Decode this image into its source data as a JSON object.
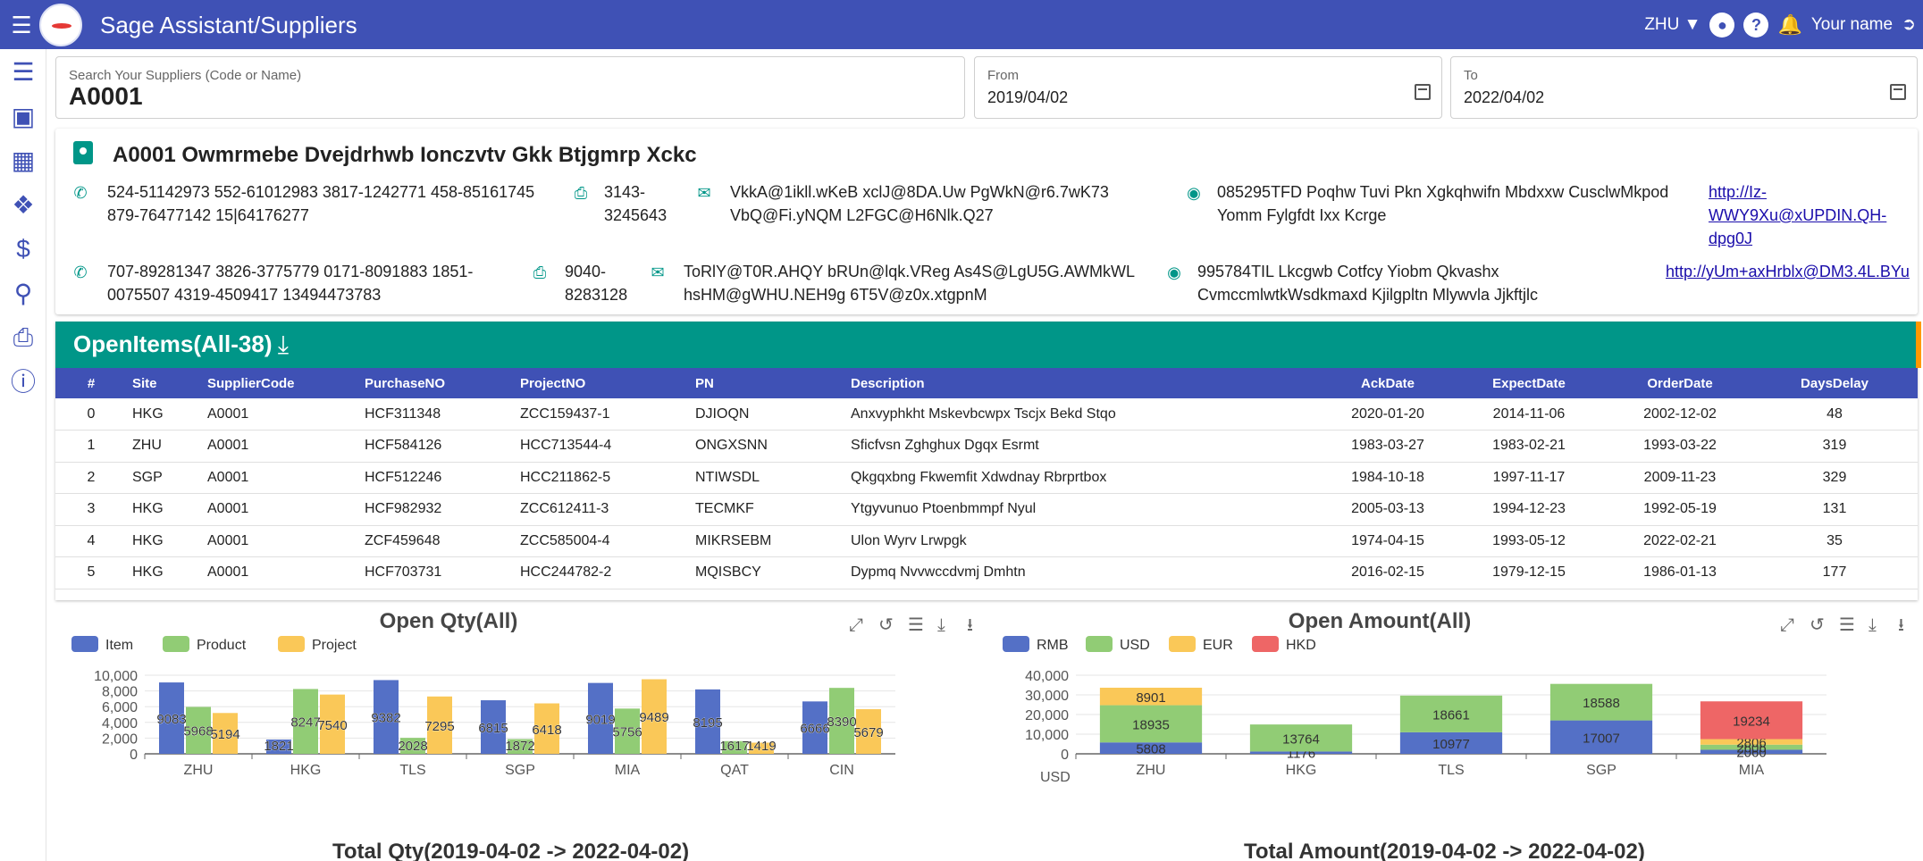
{
  "app": {
    "title": "Sage Assistant/Suppliers",
    "site": "ZHU",
    "user": "Your name"
  },
  "colors": {
    "primary": "#3f51b5",
    "teal": "#009688",
    "accent": "#ff9800"
  },
  "sidebar": {
    "icons": [
      "list-icon",
      "cubes-icon",
      "grid-icon",
      "puzzle-icon",
      "dollar-icon",
      "search-money-icon",
      "print-icon",
      "info-icon"
    ]
  },
  "search": {
    "label": "Search Your Suppliers (Code or Name)",
    "value": "A0001"
  },
  "from": {
    "label": "From",
    "value": "2019/04/02"
  },
  "to": {
    "label": "To",
    "value": "2022/04/02"
  },
  "supplier": {
    "name": "A0001 Owmrmebe Dvejdrhwb Ionczvtv Gkk Btjgmrp Xckc",
    "rows": [
      {
        "phones": [
          "524-51142973 552-61012983 3817-1242771 458-85161745",
          "879-76477142 15|64176277"
        ],
        "fax": [
          "3143-",
          "3245643"
        ],
        "emails": [
          "VkkA@1ikll.wKeB xclJ@8DA.Uw PgWkN@r6.7wK73",
          "VbQ@Fi.yNQM L2FGC@H6Nlk.Q27"
        ],
        "address": [
          "085295TFD Poqhw Tuvi Pkn Xgkqhwifn Mbdxxw CusclwMkpod",
          "Yomm Fylgfdt Ixx Kcrge"
        ],
        "url": [
          "http://Iz-",
          "WWY9Xu@xUPDIN.QH-",
          "dpg0J"
        ]
      },
      {
        "phones": [
          "707-89281347 3826-3775779 0171-8091883 1851-",
          "0075507 4319-4509417 13494473783"
        ],
        "fax": [
          "9040-",
          "8283128"
        ],
        "emails": [
          "ToRlY@T0R.AHQY bRUn@lqk.VReg As4S@LgU5G.AWMkWL",
          "hsHM@gWHU.NEH9g 6T5V@z0x.xtgpnM"
        ],
        "address": [
          "995784TIL Lkcgwb Cotfcy Yiobm Qkvashx",
          "CvmccmlwtkWsdkmaxd Kjilgpltn Mlywvla Jjkftjlc"
        ],
        "url": [
          "http://yUm+axHrblx@DM3.4L.BYu"
        ]
      }
    ]
  },
  "open_items": {
    "title": "OpenItems(All-38)",
    "columns": [
      "#",
      "Site",
      "SupplierCode",
      "PurchaseNO",
      "ProjectNO",
      "PN",
      "Description",
      "AckDate",
      "ExpectDate",
      "OrderDate",
      "DaysDelay"
    ],
    "rows": [
      [
        "0",
        "HKG",
        "A0001",
        "HCF311348",
        "ZCC159437-1",
        "DJIOQN",
        "Anxvyphkht Mskevbcwpx Tscjx Bekd Stqo",
        "2020-01-20",
        "2014-11-06",
        "2002-12-02",
        "48"
      ],
      [
        "1",
        "ZHU",
        "A0001",
        "HCF584126",
        "HCC713544-4",
        "ONGXSNN",
        "Sficfvsn Zghghux Dgqx Esrmt",
        "1983-03-27",
        "1983-02-21",
        "1993-03-22",
        "319"
      ],
      [
        "2",
        "SGP",
        "A0001",
        "HCF512246",
        "HCC211862-5",
        "NTIWSDL",
        "Qkgqxbng Fkwemfit Xdwdnay Rbrprtbox",
        "1984-10-18",
        "1997-11-17",
        "2009-11-23",
        "329"
      ],
      [
        "3",
        "HKG",
        "A0001",
        "HCF982932",
        "ZCC612411-3",
        "TECMKF",
        "Ytgyvunuo Ptoenbmmpf Nyul",
        "2005-03-13",
        "1994-12-23",
        "1992-05-19",
        "131"
      ],
      [
        "4",
        "HKG",
        "A0001",
        "ZCF459648",
        "ZCC585004-4",
        "MIKRSEBM",
        "Ulon Wyrv Lrwpgk",
        "1974-04-15",
        "1993-05-12",
        "2022-02-21",
        "35"
      ],
      [
        "5",
        "HKG",
        "A0001",
        "HCF703731",
        "HCC244782-2",
        "MQISBCY",
        "Dypmq Nvvwccdvmj Dmhtn",
        "2016-02-15",
        "1979-12-15",
        "1986-01-13",
        "177"
      ]
    ]
  },
  "chart_data": [
    {
      "type": "bar",
      "title": "Open Qty(All)",
      "categories": [
        "ZHU",
        "HKG",
        "TLS",
        "SGP",
        "MIA",
        "QAT",
        "CIN"
      ],
      "series": [
        {
          "name": "Item",
          "color": "#5470c6",
          "values": [
            9083,
            1821,
            9382,
            6815,
            9019,
            8195,
            6666
          ]
        },
        {
          "name": "Product",
          "color": "#91cc75",
          "values": [
            5968,
            8247,
            2028,
            1872,
            5756,
            1617,
            8390
          ]
        },
        {
          "name": "Project",
          "color": "#fac858",
          "values": [
            5194,
            7540,
            7295,
            6418,
            9489,
            1419,
            5679
          ]
        }
      ],
      "ylim": [
        0,
        10000
      ],
      "yticks": [
        "10,000",
        "8,000",
        "6,000",
        "4,000",
        "2,000",
        "0"
      ],
      "legend": "top-left",
      "toolbox": [
        "zoom-icon",
        "zoom-reset-icon",
        "data-view-icon",
        "restore-icon",
        "save-image-icon"
      ]
    },
    {
      "type": "bar",
      "stacked": true,
      "title": "Open Amount(All)",
      "categories": [
        "ZHU",
        "HKG",
        "TLS",
        "SGP",
        "MIA"
      ],
      "series": [
        {
          "name": "RMB",
          "color": "#5470c6",
          "values": [
            5808,
            1176,
            10977,
            17007,
            2060
          ]
        },
        {
          "name": "USD",
          "color": "#91cc75",
          "values": [
            18935,
            13764,
            18661,
            18588,
            2606
          ]
        },
        {
          "name": "EUR",
          "color": "#fac858",
          "values": [
            8901,
            0,
            0,
            0,
            2806
          ]
        },
        {
          "name": "HKD",
          "color": "#ee6666",
          "values": [
            0,
            0,
            0,
            0,
            19234
          ]
        }
      ],
      "ylim": [
        0,
        40000
      ],
      "yticks": [
        "40,000",
        "30,000",
        "20,000",
        "10,000",
        "0"
      ],
      "yunit": "USD",
      "legend": "top-left",
      "toolbox": [
        "zoom-icon",
        "zoom-reset-icon",
        "data-view-icon",
        "restore-icon",
        "save-image-icon"
      ]
    }
  ],
  "next_charts": {
    "left": "Total Qty(2019-04-02 -> 2022-04-02)",
    "right": "Total Amount(2019-04-02 -> 2022-04-02)"
  }
}
